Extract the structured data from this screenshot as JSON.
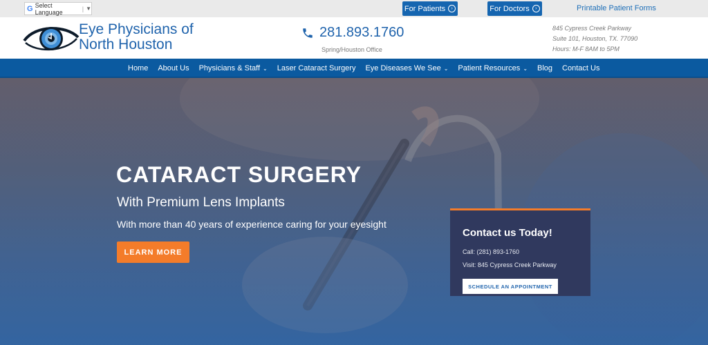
{
  "topbar": {
    "language_label": "Select Language",
    "for_patients": "For Patients",
    "for_doctors": "For Doctors",
    "forms_link": "Printable Patient Forms"
  },
  "header": {
    "logo_line1": "Eye Physicians of",
    "logo_line2": "North Houston",
    "phone": "281.893.1760",
    "office": "Spring/Houston Office",
    "address_line1": "845 Cypress Creek Parkway",
    "address_line2": "Suite 101, Houston, TX. 77090",
    "hours": "Hours: M-F 8AM to 5PM"
  },
  "nav": {
    "items": [
      {
        "label": "Home",
        "dropdown": false
      },
      {
        "label": "About Us",
        "dropdown": false
      },
      {
        "label": "Physicians & Staff",
        "dropdown": true
      },
      {
        "label": "Laser Cataract Surgery",
        "dropdown": false
      },
      {
        "label": "Eye Diseases We See",
        "dropdown": true
      },
      {
        "label": "Patient Resources",
        "dropdown": true
      },
      {
        "label": "Blog",
        "dropdown": false
      },
      {
        "label": "Contact Us",
        "dropdown": false
      }
    ]
  },
  "hero": {
    "title": "CATARACT SURGERY",
    "subtitle": "With Premium Lens Implants",
    "description": "With more than 40 years of experience caring for your eyesight",
    "cta": "LEARN MORE"
  },
  "contact_box": {
    "title": "Contact us Today!",
    "call": "Call: (281) 893-1760",
    "visit": "Visit: 845 Cypress Creek Parkway",
    "button": "SCHEDULE AN APPOINTMENT"
  },
  "colors": {
    "brand_blue": "#1f63ac",
    "nav_blue": "#0b5aa0",
    "accent_orange": "#f47c2a",
    "contact_box_bg": "#30395e"
  },
  "icons": {
    "language": "google-g-icon",
    "patients_arrow": "circle-arrow-right-icon",
    "doctors_arrow": "circle-arrow-right-icon",
    "phone": "phone-icon",
    "logo": "eye-logo-icon",
    "dropdown": "chevron-down-icon"
  }
}
